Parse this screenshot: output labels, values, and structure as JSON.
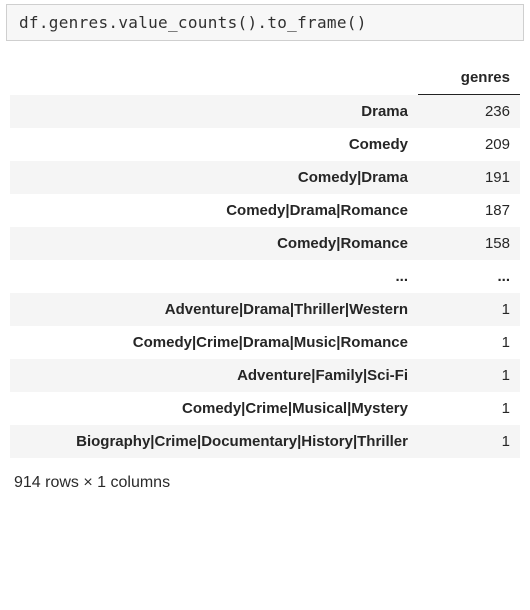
{
  "code": "df.genres.value_counts().to_frame()",
  "table": {
    "column_header": "genres",
    "rows": [
      {
        "label": "Drama",
        "value": "236"
      },
      {
        "label": "Comedy",
        "value": "209"
      },
      {
        "label": "Comedy|Drama",
        "value": "191"
      },
      {
        "label": "Comedy|Drama|Romance",
        "value": "187"
      },
      {
        "label": "Comedy|Romance",
        "value": "158"
      }
    ],
    "ellipsis_label": "...",
    "ellipsis_value": "...",
    "tail_rows": [
      {
        "label": "Adventure|Drama|Thriller|Western",
        "value": "1"
      },
      {
        "label": "Comedy|Crime|Drama|Music|Romance",
        "value": "1"
      },
      {
        "label": "Adventure|Family|Sci-Fi",
        "value": "1"
      },
      {
        "label": "Comedy|Crime|Musical|Mystery",
        "value": "1"
      },
      {
        "label": "Biography|Crime|Documentary|History|Thriller",
        "value": "1"
      }
    ],
    "shape_info": "914 rows × 1 columns"
  }
}
